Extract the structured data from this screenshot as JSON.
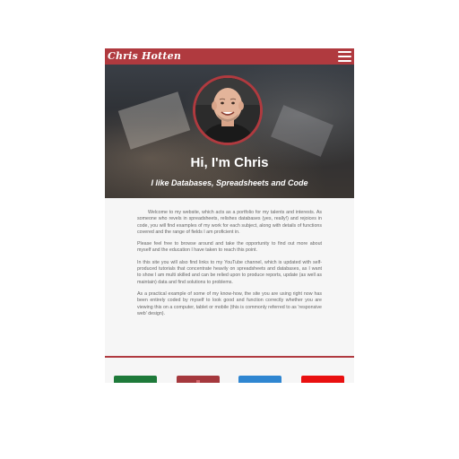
{
  "navbar": {
    "brand": "Chris Hotten",
    "menu_icon": "hamburger-menu-icon",
    "background": "#b03a3f"
  },
  "hero": {
    "title": "Hi, I'm Chris",
    "subtitle": "I like Databases, Spreadsheets and Code",
    "avatar_border": "#b03a3f"
  },
  "content": {
    "paragraphs": [
      "Welcome to my website, which acts as a portfolio for my talents and interests. As someone who revels in spreadsheets, relishes databases (yes, really!) and rejoices in code, you will find examples of my work for each subject, along with details of functions covered and the range of fields I am proficient in.",
      "Please feel free to browse around and take the opportunity to find out more about myself and the education I have taken to reach this point.",
      "In this site you will also find links to my YouTube channel, which is updated with self-produced tutorials that concentrate heavily on spreadsheets and databases, as I want to show I am multi skilled and can be relied upon to produce reports, update (as well as maintain) data and find solutions to problems.",
      "As a practical example of some of my know-how, the site you are using right now has been entirely coded by myself to look good and function correctly whether you are viewing this on a computer, tablet or mobile (this is commonly referred to as 'responsive web' design)."
    ]
  },
  "social": [
    {
      "icon": "spreadsheet-icon",
      "color": "#1e7a3a"
    },
    {
      "icon": "database-icon",
      "color": "#a5383d"
    },
    {
      "icon": "code-icon",
      "color": "#2f86d1"
    },
    {
      "icon": "youtube-icon",
      "color": "#e91010"
    }
  ]
}
